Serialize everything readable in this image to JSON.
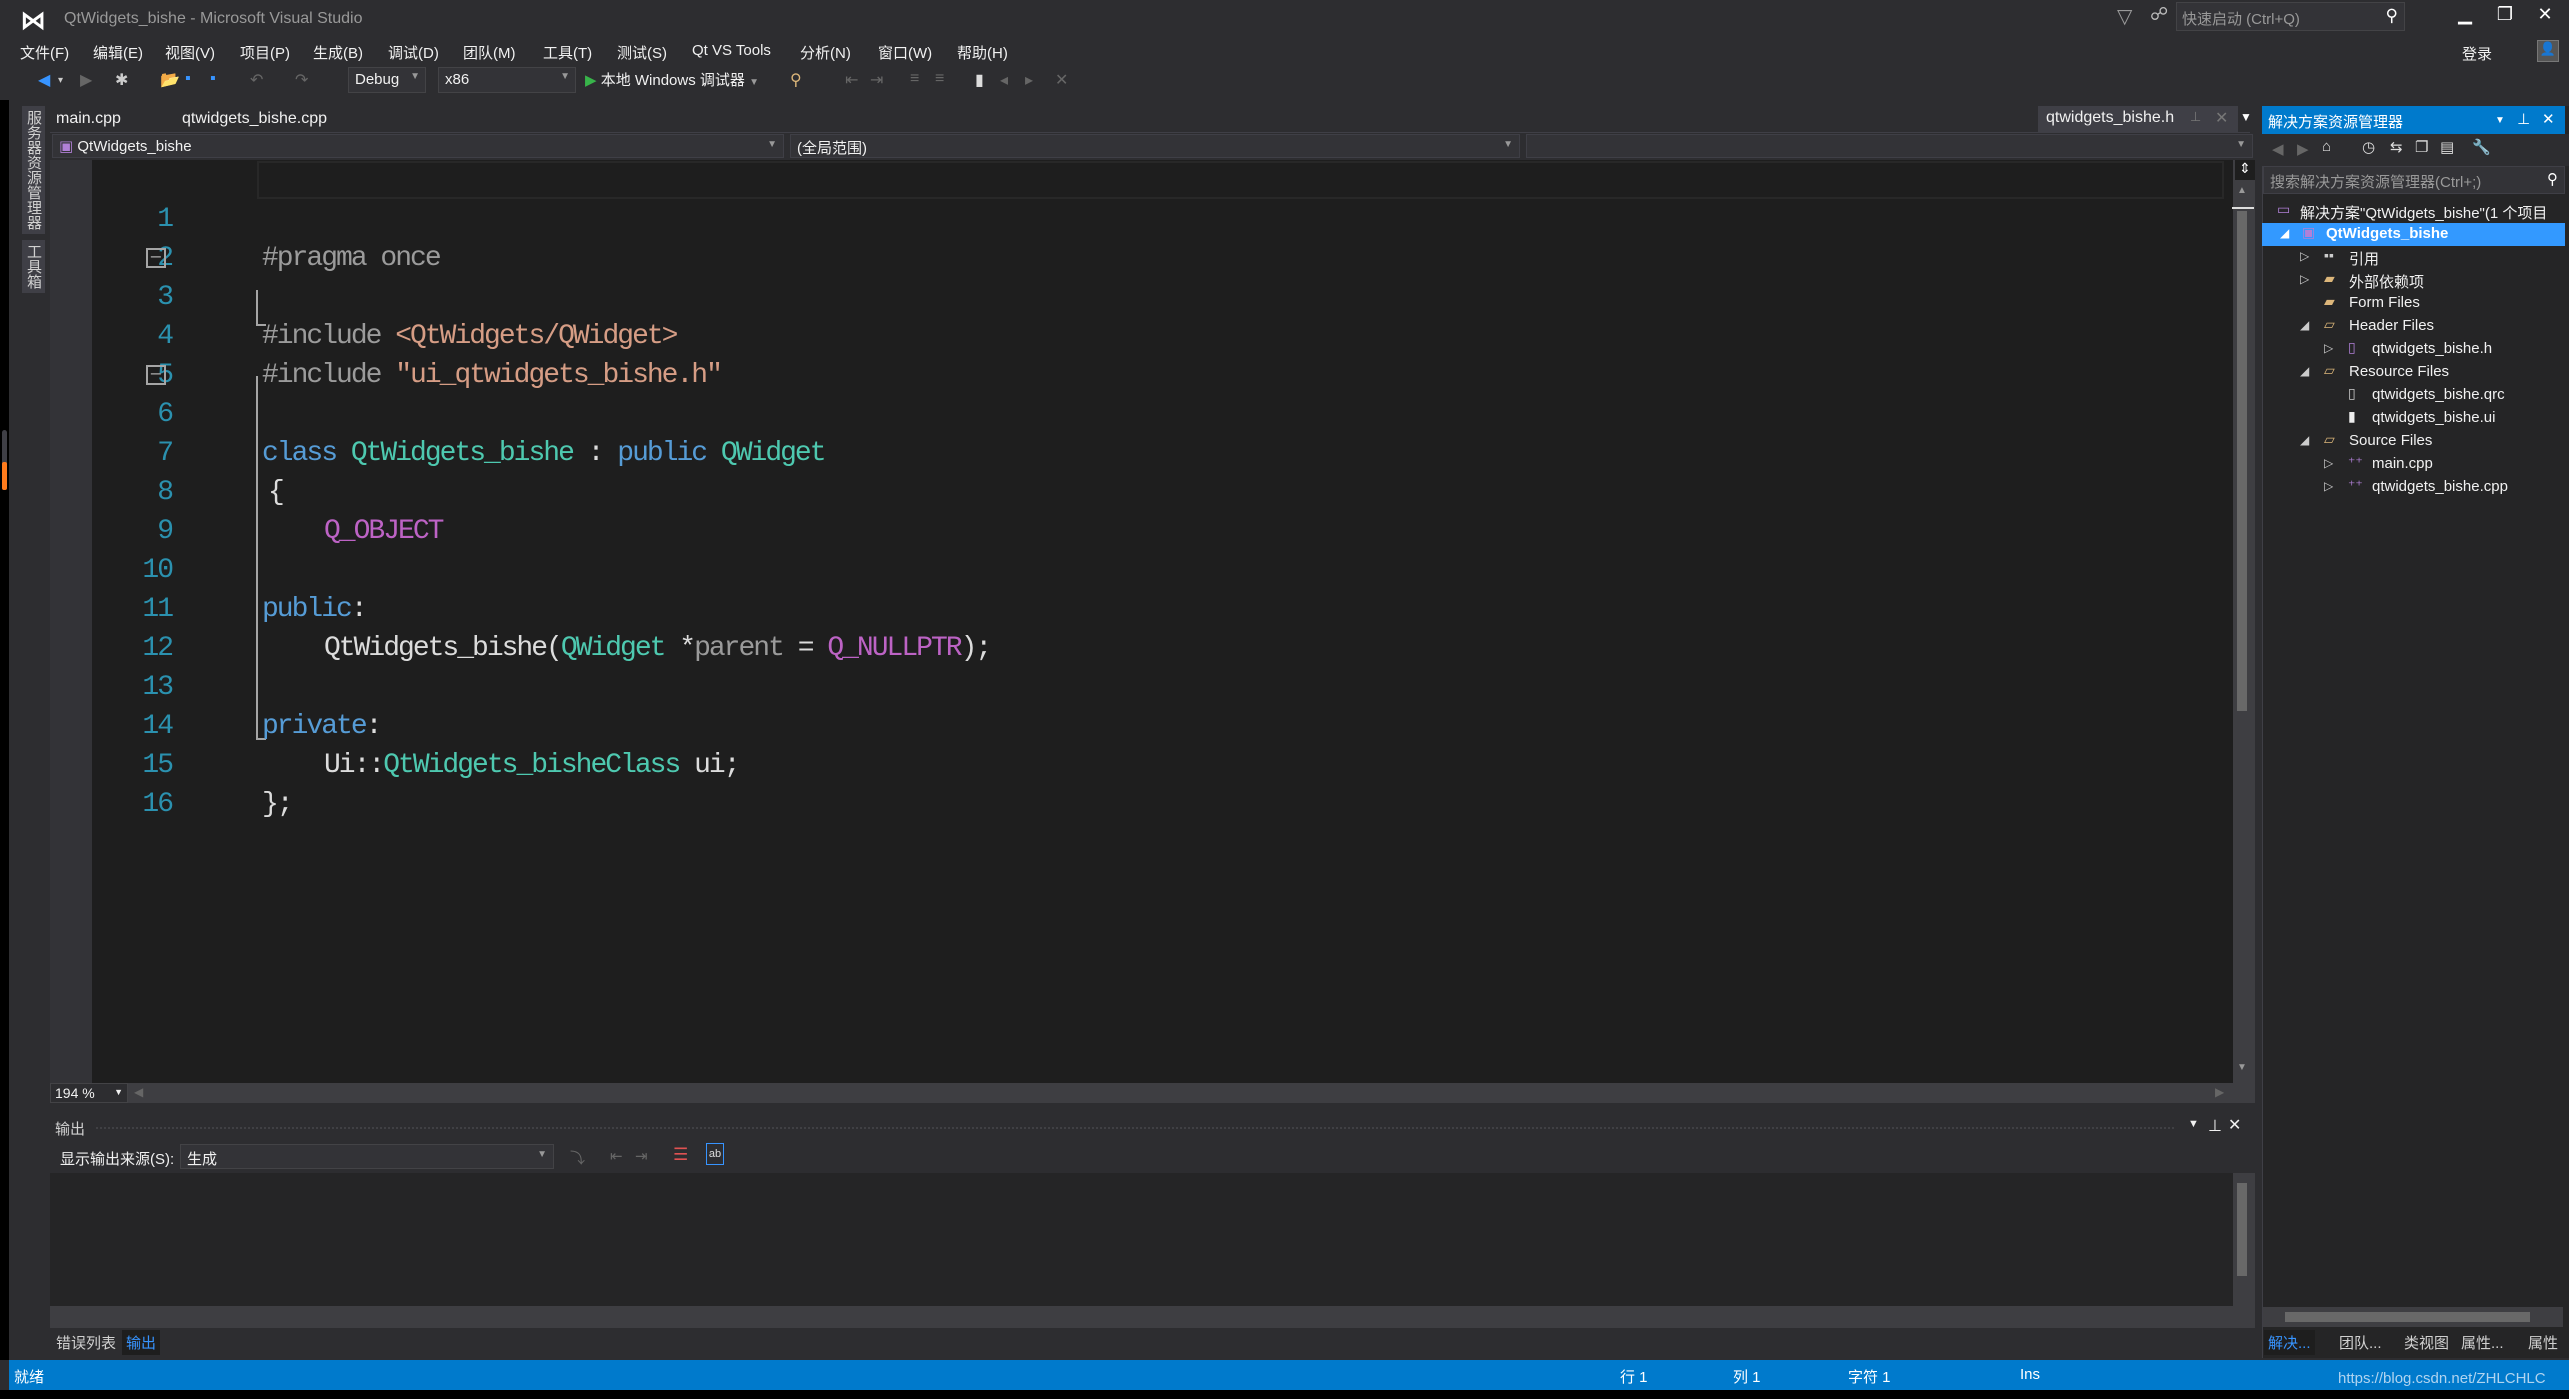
{
  "window": {
    "title": "QtWidgets_bishe - Microsoft Visual Studio",
    "quick_launch_placeholder": "快速启动 (Ctrl+Q)",
    "login_label": "登录",
    "minimize": "▁",
    "restore": "❐",
    "close": "✕"
  },
  "menu": [
    "文件(F)",
    "编辑(E)",
    "视图(V)",
    "项目(P)",
    "生成(B)",
    "调试(D)",
    "团队(M)",
    "工具(T)",
    "测试(S)",
    "Qt VS Tools",
    "分析(N)",
    "窗口(W)",
    "帮助(H)"
  ],
  "toolbar": {
    "config": "Debug",
    "platform": "x86",
    "run_label": "本地 Windows 调试器"
  },
  "left_strip": {
    "server_explorer": "服务器资源管理器",
    "toolbox": "工具箱"
  },
  "doc_tabs": {
    "tab1": "main.cpp",
    "tab2": "qtwidgets_bishe.cpp",
    "active": "qtwidgets_bishe.h"
  },
  "nav": {
    "project": "QtWidgets_bishe",
    "scope": "(全局范围)"
  },
  "editor": {
    "zoom": "194 %",
    "lines": [
      {
        "n": "1"
      },
      {
        "n": "2"
      },
      {
        "n": "3"
      },
      {
        "n": "4"
      },
      {
        "n": "5"
      },
      {
        "n": "6"
      },
      {
        "n": "7"
      },
      {
        "n": "8"
      },
      {
        "n": "9"
      },
      {
        "n": "10"
      },
      {
        "n": "11"
      },
      {
        "n": "12"
      },
      {
        "n": "13"
      },
      {
        "n": "14"
      },
      {
        "n": "15"
      },
      {
        "n": "16"
      }
    ],
    "tokens": {
      "l1_pp": "#pragma once",
      "l3_pp": "#include ",
      "l3_str": "<QtWidgets/QWidget>",
      "l4_pp": "#include ",
      "l4_str": "\"ui_qtwidgets_bishe.h\"",
      "l6_kw": "class ",
      "l6_ty": "QtWidgets_bishe",
      "l6_pn": " : ",
      "l6_kw2": "public ",
      "l6_ty2": "QWidget",
      "l7": "{",
      "l8": "Q_OBJECT",
      "l10": "public",
      "colon": ":",
      "l11_fn": "QtWidgets_bishe(",
      "l11_ty": "QWidget",
      "l11_star": " *",
      "l11_prm": "parent",
      "l11_eq": " = ",
      "l11_mac": "Q_NULLPTR",
      "l11_end": ");",
      "l13": "private",
      "l14_ns": "Ui::",
      "l14_ty": "QtWidgets_bisheClass",
      "l14_end": " ui;",
      "l15": "};"
    }
  },
  "output": {
    "title": "输出",
    "source_label": "显示输出来源(S):",
    "source_value": "生成"
  },
  "bottom_tabs": {
    "errors": "错误列表",
    "output": "输出"
  },
  "solution_explorer": {
    "title": "解决方案资源管理器",
    "search_placeholder": "搜索解决方案资源管理器(Ctrl+;)",
    "tree": [
      {
        "label": "解决方案\"QtWidgets_bishe\"(1 个项目",
        "icon": "solution-icon"
      },
      {
        "label": "QtWidgets_bishe",
        "icon": "project-icon",
        "selected": true
      },
      {
        "label": "引用",
        "icon": "references-icon"
      },
      {
        "label": "外部依赖项",
        "icon": "external-deps-icon"
      },
      {
        "label": "Form Files",
        "icon": "filter-folder-icon"
      },
      {
        "label": "Header Files",
        "icon": "filter-folder-icon"
      },
      {
        "label": "qtwidgets_bishe.h",
        "icon": "header-file-icon"
      },
      {
        "label": "Resource Files",
        "icon": "filter-folder-icon"
      },
      {
        "label": "qtwidgets_bishe.qrc",
        "icon": "file-icon"
      },
      {
        "label": "qtwidgets_bishe.ui",
        "icon": "ui-file-icon"
      },
      {
        "label": "Source Files",
        "icon": "filter-folder-icon"
      },
      {
        "label": "main.cpp",
        "icon": "cpp-file-icon"
      },
      {
        "label": "qtwidgets_bishe.cpp",
        "icon": "cpp-file-icon"
      }
    ],
    "bottom_tabs": [
      "解决...",
      "团队...",
      "类视图",
      "属性...",
      "属性"
    ]
  },
  "status": {
    "ready": "就绪",
    "line": "行 1",
    "col": "列 1",
    "char": "字符 1",
    "mode": "Ins",
    "watermark": "https://blog.csdn.net/ZHLCHLC"
  },
  "colors": {
    "accent": "#007acc",
    "background": "#2d2d30",
    "editor_bg": "#1e1e1e",
    "line_number": "#2b91af",
    "keyword": "#569cd6",
    "type": "#4ec9b0",
    "string": "#d69d85",
    "macro": "#bd63c5"
  }
}
